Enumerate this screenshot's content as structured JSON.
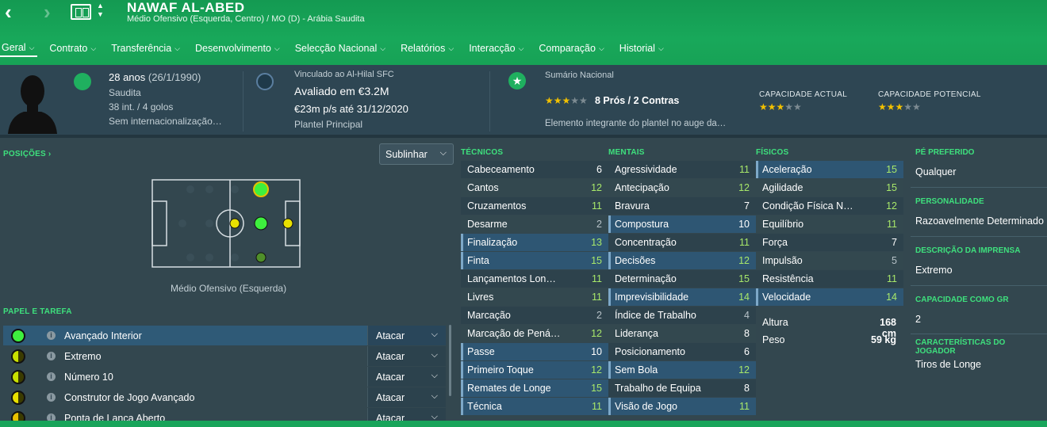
{
  "header": {
    "player_name": "NAWAF AL-ABED",
    "subtitle": "Médio Ofensivo (Esquerda, Centro) / MO (D) - Arábia Saudita",
    "back_icon": "‹",
    "forward_icon": "›",
    "accent_color": "#18a85a"
  },
  "menu": [
    {
      "label": "Geral",
      "active": true
    },
    {
      "label": "Contrato"
    },
    {
      "label": "Transferência"
    },
    {
      "label": "Desenvolvimento"
    },
    {
      "label": "Selecção Nacional"
    },
    {
      "label": "Relatórios"
    },
    {
      "label": "Interacção"
    },
    {
      "label": "Comparação"
    },
    {
      "label": "Historial"
    }
  ],
  "info": {
    "age": "28 anos",
    "dob": "(26/1/1990)",
    "nationality": "Saudita",
    "caps": "38 int. / 4 golos",
    "international": "Sem internacionalização…",
    "club_link": "Vinculado ao Al-Hilal SFC",
    "value": "Avaliado em €3.2M",
    "wage": "€23m p/s até 31/12/2020",
    "squad": "Plantel Principal",
    "national_summary_label": "Sumário Nacional",
    "national_summary": "8 Prós / 2 Contras",
    "national_summary_stars": 3,
    "national_comment": "Elemento integrante do plantel no auge da…",
    "current_ability_label": "CAPACIDADE ACTUAL",
    "current_ability_stars": 3,
    "potential_ability_label": "CAPACIDADE POTENCIAL",
    "potential_ability_stars": 3
  },
  "positions": {
    "label": "POSIÇÕES ›",
    "highlight_button": "Sublinhar",
    "position_caption": "Médio Ofensivo (Esquerda)"
  },
  "roles": {
    "label": "PAPEL E TAREFA",
    "items": [
      {
        "name": "Avançado Interior",
        "duty": "Atacar",
        "rating_color": "#3ef03e",
        "active": true
      },
      {
        "name": "Extremo",
        "duty": "Atacar",
        "rating_color": "half"
      },
      {
        "name": "Número 10",
        "duty": "Atacar",
        "rating_color": "half"
      },
      {
        "name": "Construtor de Jogo Avançado",
        "duty": "Atacar",
        "rating_color": "half"
      },
      {
        "name": "Ponta de Lança Aberto",
        "duty": "Atacar",
        "rating_color": "half"
      }
    ]
  },
  "attributes": {
    "technical_label": "TÉCNICOS",
    "mental_label": "MENTAIS",
    "physical_label": "FÍSICOS",
    "technical": [
      {
        "name": "Cabeceamento",
        "value": "6"
      },
      {
        "name": "Cantos",
        "value": "12"
      },
      {
        "name": "Cruzamentos",
        "value": "11"
      },
      {
        "name": "Desarme",
        "value": "2"
      },
      {
        "name": "Finalização",
        "value": "13",
        "hl": true
      },
      {
        "name": "Finta",
        "value": "15",
        "hl": true
      },
      {
        "name": "Lançamentos Lon…",
        "value": "11"
      },
      {
        "name": "Livres",
        "value": "11"
      },
      {
        "name": "Marcação",
        "value": "2"
      },
      {
        "name": "Marcação de Pená…",
        "value": "12"
      },
      {
        "name": "Passe",
        "value": "10",
        "hl": true
      },
      {
        "name": "Primeiro Toque",
        "value": "12",
        "hl": true
      },
      {
        "name": "Remates de Longe",
        "value": "15",
        "hl": true
      },
      {
        "name": "Técnica",
        "value": "11",
        "hl": true
      }
    ],
    "mental": [
      {
        "name": "Agressividade",
        "value": "11"
      },
      {
        "name": "Antecipação",
        "value": "12"
      },
      {
        "name": "Bravura",
        "value": "7"
      },
      {
        "name": "Compostura",
        "value": "10",
        "hl": true
      },
      {
        "name": "Concentração",
        "value": "11"
      },
      {
        "name": "Decisões",
        "value": "12",
        "hl": true
      },
      {
        "name": "Determinação",
        "value": "15"
      },
      {
        "name": "Imprevisibilidade",
        "value": "14",
        "hl": true
      },
      {
        "name": "Índice de Trabalho",
        "value": "4"
      },
      {
        "name": "Liderança",
        "value": "8"
      },
      {
        "name": "Posicionamento",
        "value": "6"
      },
      {
        "name": "Sem Bola",
        "value": "12",
        "hl": true
      },
      {
        "name": "Trabalho de Equipa",
        "value": "8"
      },
      {
        "name": "Visão de Jogo",
        "value": "11",
        "hl": true
      }
    ],
    "physical": [
      {
        "name": "Aceleração",
        "value": "15",
        "hl": true
      },
      {
        "name": "Agilidade",
        "value": "15"
      },
      {
        "name": "Condição Física N…",
        "value": "12"
      },
      {
        "name": "Equilíbrio",
        "value": "11"
      },
      {
        "name": "Força",
        "value": "7"
      },
      {
        "name": "Impulsão",
        "value": "5"
      },
      {
        "name": "Resistência",
        "value": "11"
      },
      {
        "name": "Velocidade",
        "value": "14",
        "hl": true
      }
    ],
    "height_label": "Altura",
    "height": "168 cm",
    "weight_label": "Peso",
    "weight": "59 kg"
  },
  "side": {
    "preferred_foot_label": "PÉ PREFERIDO",
    "preferred_foot": "Qualquer",
    "personality_label": "PERSONALIDADE",
    "personality": "Razoavelmente Determinado",
    "media_label": "DESCRIÇÃO DA IMPRENSA",
    "media": "Extremo",
    "gk_label": "CAPACIDADE COMO GR",
    "gk": "2",
    "traits_label": "CARACTERÍSTICAS DO JOGADOR",
    "traits": "Tiros de Longe"
  }
}
